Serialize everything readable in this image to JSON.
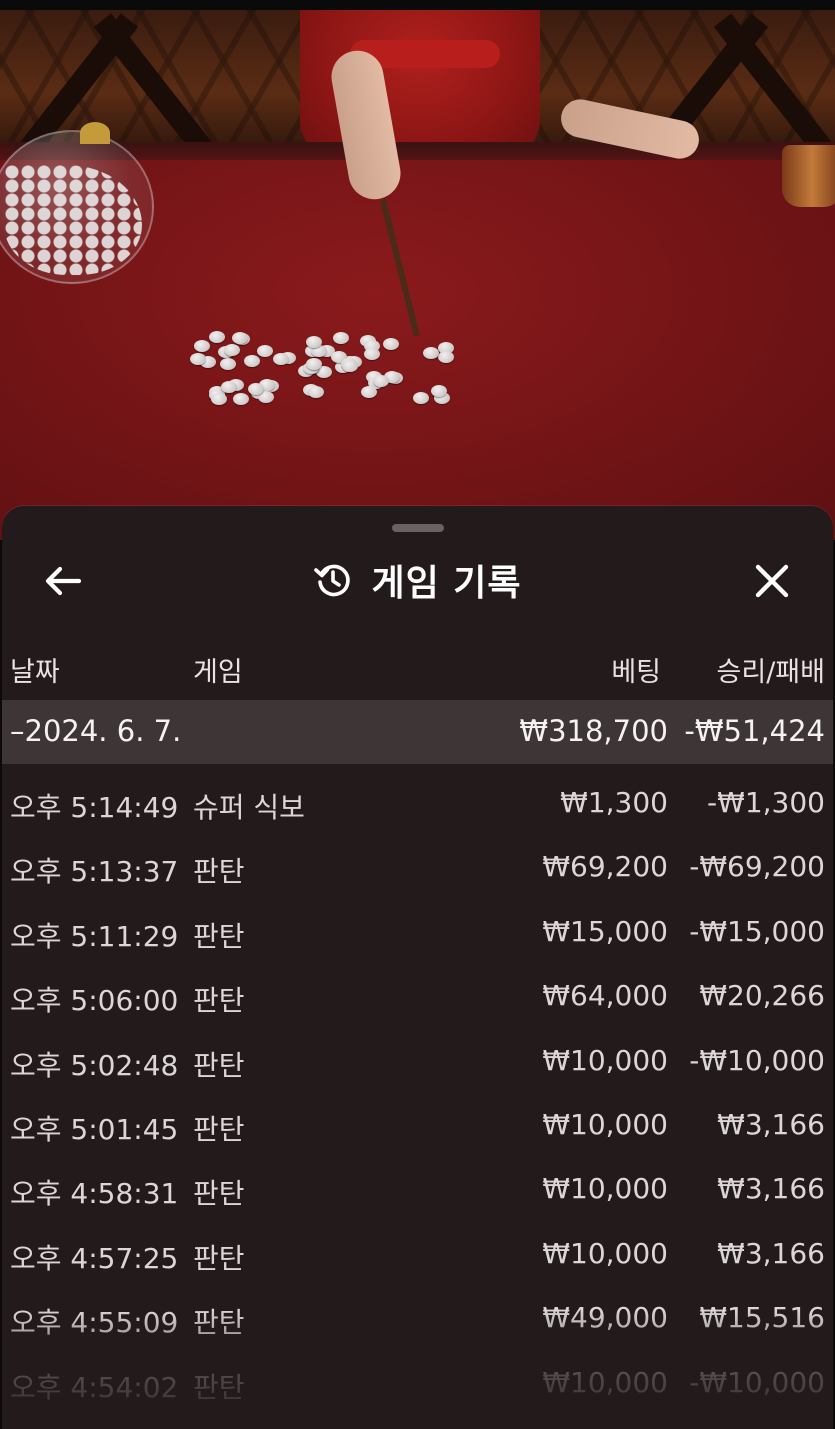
{
  "header": {
    "title": "게임 기록",
    "back_icon": "arrow-left-icon",
    "history_icon": "history-icon",
    "close_icon": "close-icon"
  },
  "columns": {
    "date": "날짜",
    "game": "게임",
    "bet": "베팅",
    "result": "승리/패배"
  },
  "day_summary": {
    "label": "–2024. 6. 7.",
    "bet_total": "₩318,700",
    "result_total": "-₩51,424"
  },
  "records": [
    {
      "time": "오후 5:14:49",
      "game": "슈퍼 식보",
      "bet": "₩1,300",
      "result": "-₩1,300"
    },
    {
      "time": "오후 5:13:37",
      "game": "판탄",
      "bet": "₩69,200",
      "result": "-₩69,200"
    },
    {
      "time": "오후 5:11:29",
      "game": "판탄",
      "bet": "₩15,000",
      "result": "-₩15,000"
    },
    {
      "time": "오후 5:06:00",
      "game": "판탄",
      "bet": "₩64,000",
      "result": "₩20,266"
    },
    {
      "time": "오후 5:02:48",
      "game": "판탄",
      "bet": "₩10,000",
      "result": "-₩10,000"
    },
    {
      "time": "오후 5:01:45",
      "game": "판탄",
      "bet": "₩10,000",
      "result": "₩3,166"
    },
    {
      "time": "오후 4:58:31",
      "game": "판탄",
      "bet": "₩10,000",
      "result": "₩3,166"
    },
    {
      "time": "오후 4:57:25",
      "game": "판탄",
      "bet": "₩10,000",
      "result": "₩3,166"
    },
    {
      "time": "오후 4:55:09",
      "game": "판탄",
      "bet": "₩49,000",
      "result": "₩15,516"
    },
    {
      "time": "오후 4:54:02",
      "game": "판탄",
      "bet": "₩10,000",
      "result": "-₩10,000"
    }
  ]
}
